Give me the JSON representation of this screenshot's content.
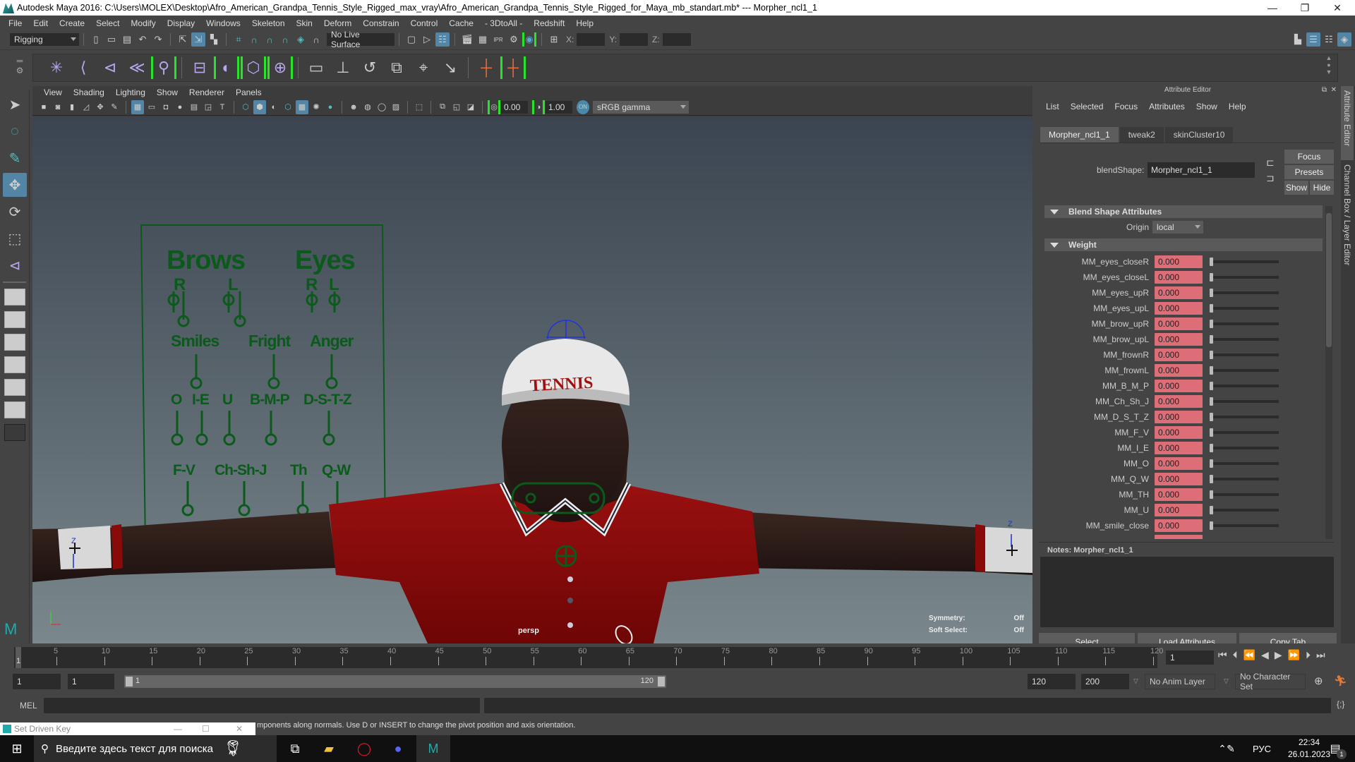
{
  "window": {
    "title": "Autodesk Maya 2016: C:\\Users\\MOLEX\\Desktop\\Afro_American_Grandpa_Tennis_Style_Rigged_max_vray\\Afro_American_Grandpa_Tennis_Style_Rigged_for_Maya_mb_standart.mb*  ---  Morpher_ncl1_1",
    "minimize": "—",
    "maximize": "❐",
    "close": "✕"
  },
  "menubar": [
    "File",
    "Edit",
    "Create",
    "Select",
    "Modify",
    "Display",
    "Windows",
    "Skeleton",
    "Skin",
    "Deform",
    "Constrain",
    "Control",
    "Cache",
    "- 3DtoAll -",
    "Redshift",
    "Help"
  ],
  "statusline": {
    "menuset": "Rigging",
    "live_surface": "No Live Surface",
    "x_label": "X:",
    "y_label": "Y:",
    "z_label": "Z:"
  },
  "viewport": {
    "menu": [
      "View",
      "Shading",
      "Lighting",
      "Show",
      "Renderer",
      "Panels"
    ],
    "exposure": "0.00",
    "gamma": "1.00",
    "color_space": "sRGB gamma",
    "camera": "persp",
    "hud": [
      {
        "label": "Symmetry:",
        "value": "Off"
      },
      {
        "label": "Soft Select:",
        "value": "Off"
      }
    ],
    "face_panel": {
      "brows": "Brows",
      "eyes": "Eyes",
      "r1": "R",
      "l1": "L",
      "r2": "R",
      "l2": "L",
      "smiles": "Smiles",
      "fright": "Fright",
      "anger": "Anger",
      "o": "O",
      "ie": "I-E",
      "u": "U",
      "bmp": "B-M-P",
      "dstz": "D-S-T-Z",
      "fv": "F-V",
      "chshj": "Ch-Sh-J",
      "th": "Th",
      "qw": "Q-W"
    },
    "cap_text": "TENNIS",
    "axis_z": "Z"
  },
  "attribute_editor": {
    "title": "Attribute Editor",
    "menu": [
      "List",
      "Selected",
      "Focus",
      "Attributes",
      "Show",
      "Help"
    ],
    "tabs": [
      "Morpher_ncl1_1",
      "tweak2",
      "skinCluster10"
    ],
    "node_label": "blendShape:",
    "node_name": "Morpher_ncl1_1",
    "focus": "Focus",
    "presets": "Presets",
    "show": "Show",
    "hide": "Hide",
    "section_blend": "Blend Shape Attributes",
    "origin_label": "Origin",
    "origin_value": "local",
    "section_weight": "Weight",
    "weights": [
      {
        "name": "MM_eyes_closeR",
        "value": "0.000",
        "fraction": 0
      },
      {
        "name": "MM_eyes_closeL",
        "value": "0.000",
        "fraction": 0
      },
      {
        "name": "MM_eyes_upR",
        "value": "0.000",
        "fraction": 0
      },
      {
        "name": "MM_eyes_upL",
        "value": "0.000",
        "fraction": 0
      },
      {
        "name": "MM_brow_upR",
        "value": "0.000",
        "fraction": 0
      },
      {
        "name": "MM_brow_upL",
        "value": "0.000",
        "fraction": 0
      },
      {
        "name": "MM_frownR",
        "value": "0.000",
        "fraction": 0
      },
      {
        "name": "MM_frownL",
        "value": "0.000",
        "fraction": 0
      },
      {
        "name": "MM_B_M_P",
        "value": "0.000",
        "fraction": 0
      },
      {
        "name": "MM_Ch_Sh_J",
        "value": "0.000",
        "fraction": 0
      },
      {
        "name": "MM_D_S_T_Z",
        "value": "0.000",
        "fraction": 0
      },
      {
        "name": "MM_F_V",
        "value": "0.000",
        "fraction": 0
      },
      {
        "name": "MM_I_E",
        "value": "0.000",
        "fraction": 0
      },
      {
        "name": "MM_O",
        "value": "0.000",
        "fraction": 0
      },
      {
        "name": "MM_Q_W",
        "value": "0.000",
        "fraction": 0
      },
      {
        "name": "MM_TH",
        "value": "0.000",
        "fraction": 0
      },
      {
        "name": "MM_U",
        "value": "0.000",
        "fraction": 0
      },
      {
        "name": "MM_smile_close",
        "value": "0.000",
        "fraction": 0
      }
    ],
    "notes_label": "Notes:  Morpher_ncl1_1",
    "bottom_buttons": [
      "Select",
      "Load Attributes",
      "Copy Tab"
    ],
    "side_tabs": [
      "Attribute Editor",
      "Channel Box / Layer Editor"
    ]
  },
  "timeline": {
    "ticks": [
      5,
      10,
      15,
      20,
      25,
      30,
      35,
      40,
      45,
      50,
      55,
      60,
      65,
      70,
      75,
      80,
      85,
      90,
      95,
      100,
      105,
      110,
      115,
      120
    ],
    "current_frame_marker": "1",
    "current_frame": "1",
    "range": {
      "start": "1",
      "playback_start": "1",
      "slider_start": "1",
      "slider_end": "120",
      "playback_end": "120",
      "end": "200"
    },
    "anim_layer": "No Anim Layer",
    "character_set": "No Character Set"
  },
  "command_line": {
    "label": "MEL"
  },
  "help_line": "mponents along normals. Use D or INSERT to change the pivot position and axis orientation.",
  "set_driven_key": {
    "title": "Set Driven Key"
  },
  "taskbar": {
    "search_placeholder": "Введите здесь текст для поиска",
    "language": "РУС",
    "time": "22:34",
    "date": "26.01.2023",
    "notification_count": "1"
  }
}
